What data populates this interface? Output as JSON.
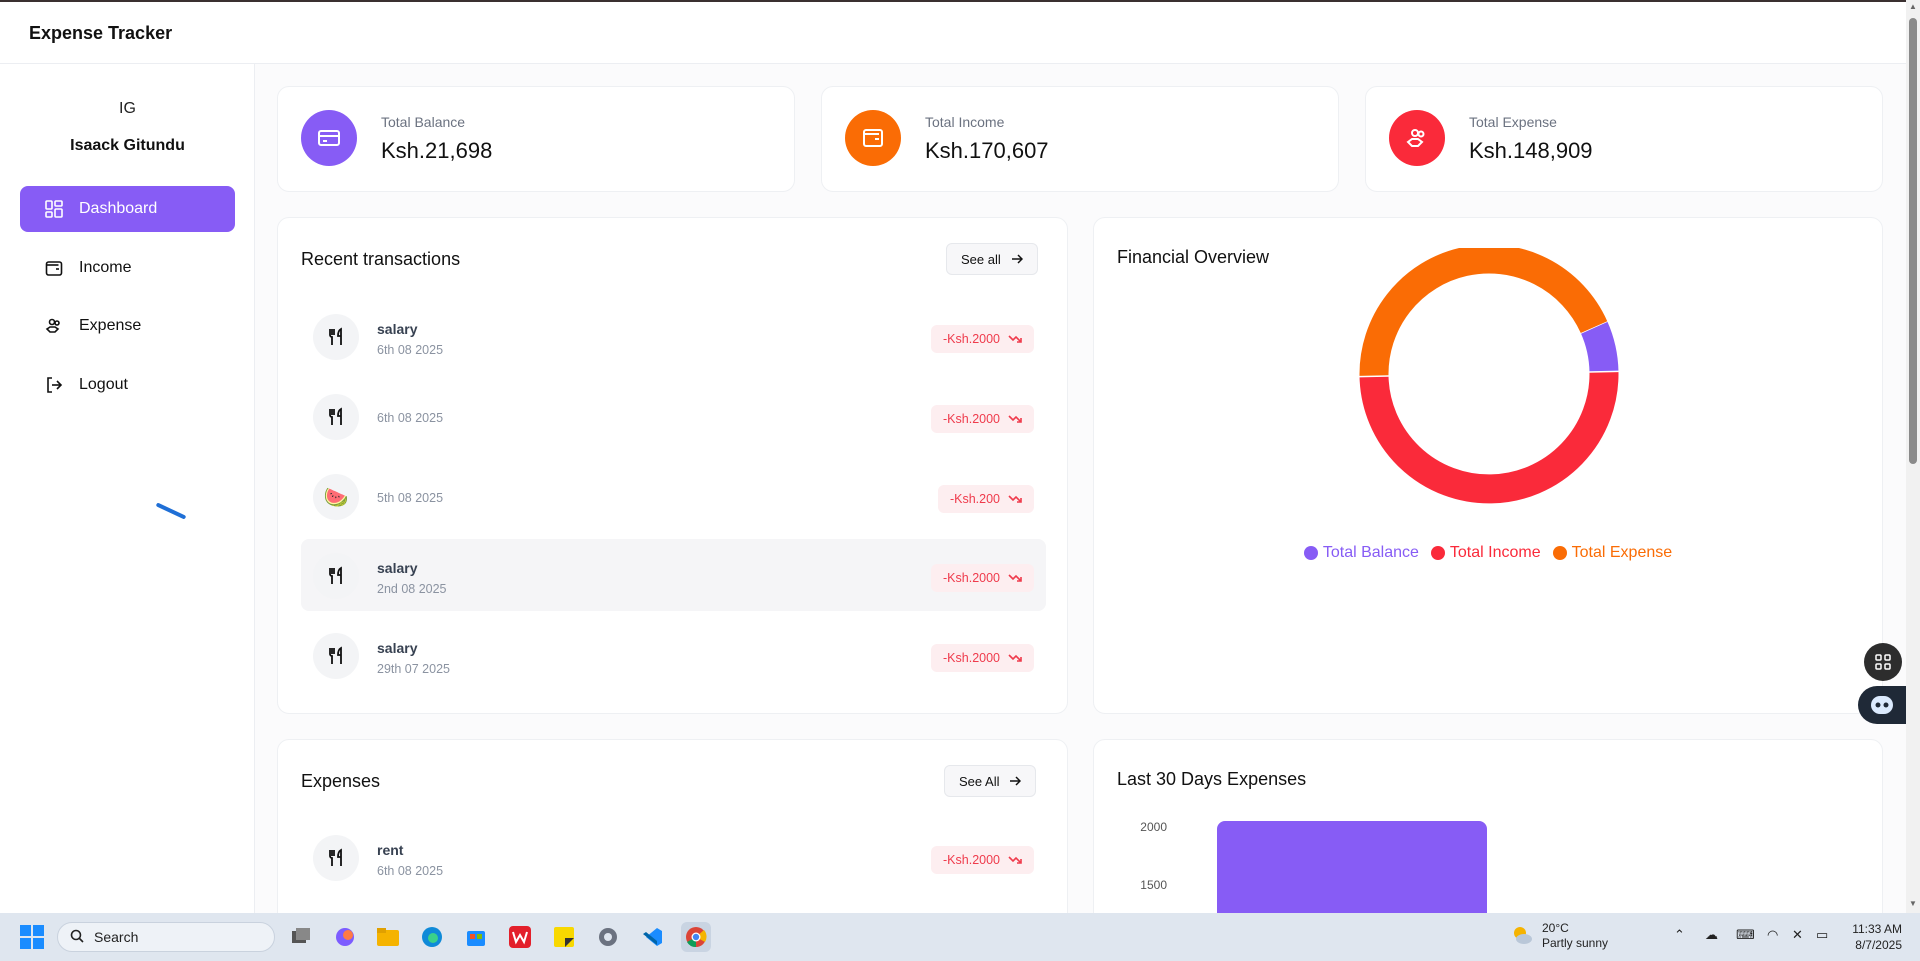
{
  "header": {
    "title": "Expense Tracker"
  },
  "user": {
    "initials": "IG",
    "name": "Isaack Gitundu"
  },
  "sidebar": {
    "items": [
      {
        "label": "Dashboard",
        "icon": "dashboard-icon",
        "active": true
      },
      {
        "label": "Income",
        "icon": "wallet-icon",
        "active": false
      },
      {
        "label": "Expense",
        "icon": "hand-coins-icon",
        "active": false
      },
      {
        "label": "Logout",
        "icon": "logout-icon",
        "active": false
      }
    ]
  },
  "stats": [
    {
      "label": "Total Balance",
      "value": "Ksh.21,698",
      "color": "#875cf5",
      "icon": "credit-card-icon"
    },
    {
      "label": "Total Income",
      "value": "Ksh.170,607",
      "color": "#fa6c05",
      "icon": "wallet-icon"
    },
    {
      "label": "Total Expense",
      "value": "Ksh.148,909",
      "color": "#fa2a3a",
      "icon": "hand-coins-icon"
    }
  ],
  "recent": {
    "title": "Recent transactions",
    "see_all": "See all",
    "items": [
      {
        "name": "salary",
        "date": "6th 08 2025",
        "amount": "-Ksh.2000",
        "icon": "utensils-icon"
      },
      {
        "name": "",
        "date": "6th 08 2025",
        "amount": "-Ksh.2000",
        "icon": "utensils-icon"
      },
      {
        "name": "",
        "date": "5th 08 2025",
        "amount": "-Ksh.200",
        "icon": "watermelon-icon",
        "emoji": "🍉"
      },
      {
        "name": "salary",
        "date": "2nd 08 2025",
        "amount": "-Ksh.2000",
        "icon": "utensils-icon"
      },
      {
        "name": "salary",
        "date": "29th 07 2025",
        "amount": "-Ksh.2000",
        "icon": "utensils-icon"
      }
    ]
  },
  "financial_overview": {
    "title": "Financial Overview",
    "legend": [
      "Total Balance",
      "Total Income",
      "Total Expense"
    ]
  },
  "expenses": {
    "title": "Expenses",
    "see_all": "See All",
    "items": [
      {
        "name": "rent",
        "date": "6th 08 2025",
        "amount": "-Ksh.2000",
        "icon": "utensils-icon"
      }
    ]
  },
  "last30": {
    "title": "Last 30 Days Expenses"
  },
  "chart_data": [
    {
      "type": "pie",
      "donut": true,
      "title": "Financial Overview",
      "categories": [
        "Total Balance",
        "Total Income",
        "Total Expense"
      ],
      "values": [
        21698,
        170607,
        148909
      ],
      "colors": [
        "#875cf5",
        "#fa2a3a",
        "#fa6c05"
      ],
      "legend": "bottom"
    },
    {
      "type": "bar",
      "title": "Last 30 Days Expenses",
      "yticks": [
        "2000",
        "1500"
      ],
      "values": [
        2000
      ],
      "colors": [
        "#875cf5"
      ]
    }
  ],
  "taskbar": {
    "search_label": "Search",
    "weather_temp": "20°C",
    "weather_desc": "Partly sunny",
    "time": "11:33 AM",
    "date": "8/7/2025"
  }
}
